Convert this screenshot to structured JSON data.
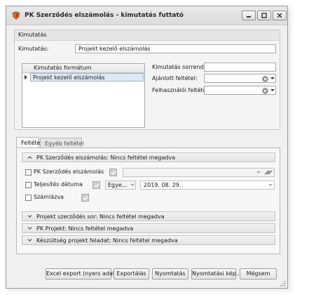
{
  "window": {
    "title": "PK Szerződés elszámolás - kimutatás futtató",
    "controls": [
      "minimize-icon",
      "maximize-icon",
      "close-icon"
    ]
  },
  "kimutatas_group": {
    "header": "Kimutatás",
    "kimutatas_label": "Kimutatás:",
    "kimutatas_value": "Projekt kezelő elszámolás",
    "grid_header": "Kimutatás formátum",
    "grid_rows": [
      "Projekt kezelő elszámolás"
    ],
    "sorrend_label": "Kimutatás sorrend:",
    "sorrend_value": "",
    "ajanlott_label": "Ajánlott feltétel:",
    "ajanlott_value": "",
    "felhasznaloi_label": "Felhasználói feltétel:",
    "felhasznaloi_value": ""
  },
  "tabs": [
    {
      "label": "Feltétel",
      "active": true
    },
    {
      "label": "Egyéb feltétel",
      "active": false
    }
  ],
  "sections": {
    "main": {
      "title": "PK Szerződés elszámolás: Nincs feltétel megadva",
      "expanded": true,
      "rows": {
        "elszamolas": {
          "label": "PK Szerződés elszámolás",
          "checked": false
        },
        "teljesites": {
          "label": "Teljesítés dátuma",
          "checked": false,
          "operator": "Egye...",
          "date": "2019. 08. 29."
        },
        "szamlazva": {
          "label": "Számlázva",
          "checked": false
        }
      }
    },
    "collapsed": [
      "Projekt szerződés sor: Nincs feltétel megadva",
      "PK Projekt: Nincs feltétel megadva",
      "Készültség projekt feladat: Nincs feltétel megadva"
    ]
  },
  "buttons": {
    "excel": "Excel export (nyers adat)",
    "export": "Exportálás",
    "print": "Nyomtatás",
    "print_image": "Nyomtatási kép...",
    "cancel": "Mégsem"
  },
  "colors": {
    "selection": "#dfe8f6",
    "selection_border": "#99b4dd",
    "app_icon": "#e06a1b"
  }
}
